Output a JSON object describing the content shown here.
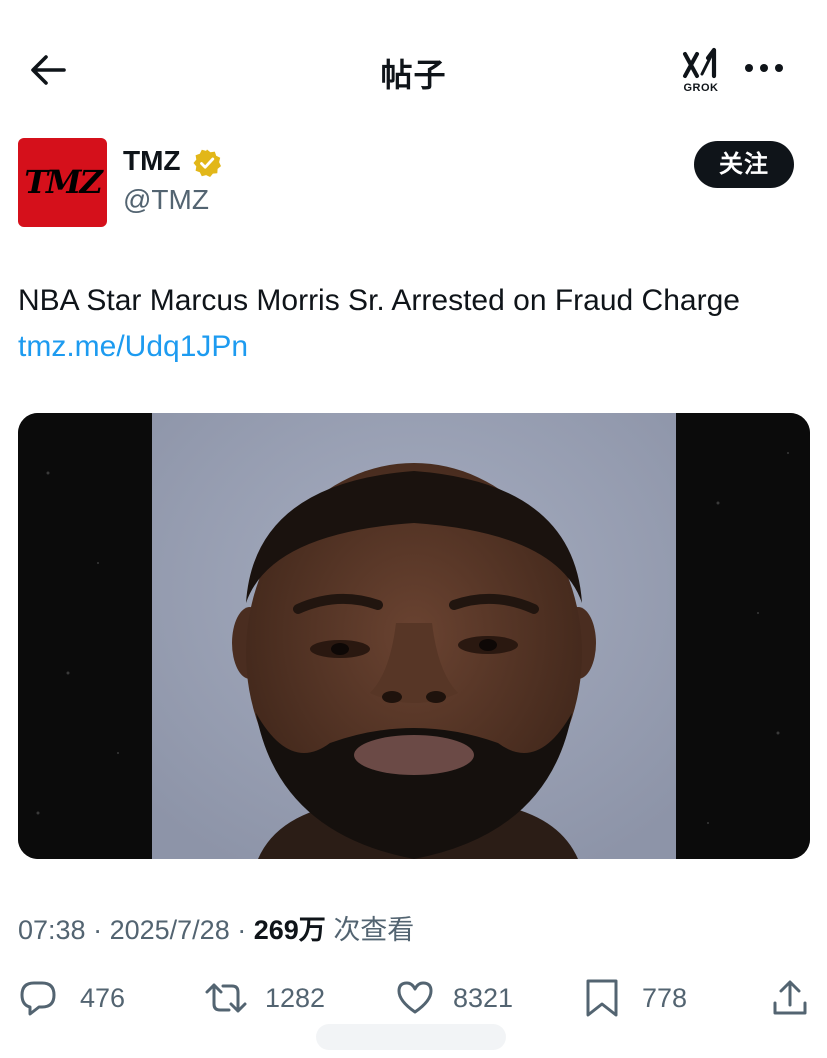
{
  "header": {
    "title": "帖子",
    "grok_label": "GROK",
    "back_icon": "arrow-left-icon",
    "more_icon": "more-horizontal-icon"
  },
  "author": {
    "avatar_text": "TMZ",
    "name": "TMZ",
    "handle": "@TMZ",
    "verified_color": "#e2b719",
    "avatar_color": "#d5101b"
  },
  "follow_label": "关注",
  "post": {
    "text": "NBA Star Marcus Morris Sr. Arrested on Fraud Charge ",
    "link": "tmz.me/Udq1JPn"
  },
  "meta": {
    "time": "07:38",
    "date": "2025/7/28",
    "views": "269万",
    "views_suffix": "次查看"
  },
  "stats": {
    "replies": "476",
    "reposts": "1282",
    "likes": "8321",
    "bookmarks": "778"
  },
  "colors": {
    "text": "#0f1419",
    "secondary": "#536471",
    "link": "#1d9bf0"
  }
}
